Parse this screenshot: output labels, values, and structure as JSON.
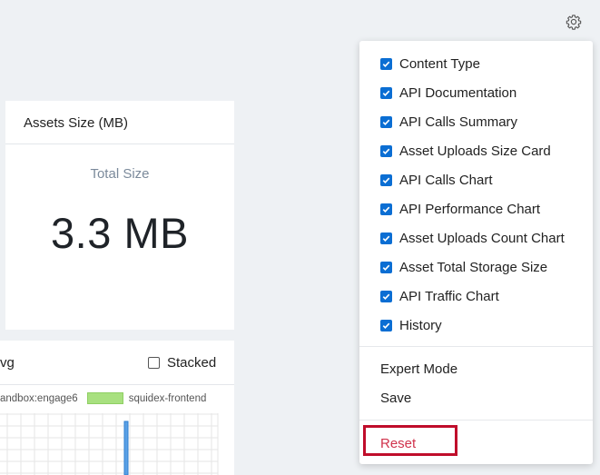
{
  "settings": {
    "icon": "gear-icon"
  },
  "assets_card": {
    "title": "Assets Size (MB)",
    "subtitle": "Total Size",
    "value": "3.3 MB"
  },
  "traffic_card": {
    "title_fragment": "vg",
    "stacked_label": "Stacked",
    "stacked_checked": false,
    "legend": [
      {
        "label": "andbox:engage6"
      },
      {
        "label": "squidex-frontend",
        "color": "#a8e07f"
      }
    ]
  },
  "menu": {
    "items": [
      {
        "label": "Content Type",
        "checked": true
      },
      {
        "label": "API Documentation",
        "checked": true
      },
      {
        "label": "API Calls Summary",
        "checked": true
      },
      {
        "label": "Asset Uploads Size Card",
        "checked": true
      },
      {
        "label": "API Calls Chart",
        "checked": true
      },
      {
        "label": "API Performance Chart",
        "checked": true
      },
      {
        "label": "Asset Uploads Count Chart",
        "checked": true
      },
      {
        "label": "Asset Total Storage Size",
        "checked": true
      },
      {
        "label": "API Traffic Chart",
        "checked": true
      },
      {
        "label": "History",
        "checked": true
      }
    ],
    "expert_mode": "Expert Mode",
    "save": "Save",
    "reset": "Reset"
  },
  "colors": {
    "accent": "#0b6ed3",
    "reset": "#d0334c",
    "highlight": "#c00d2b"
  }
}
